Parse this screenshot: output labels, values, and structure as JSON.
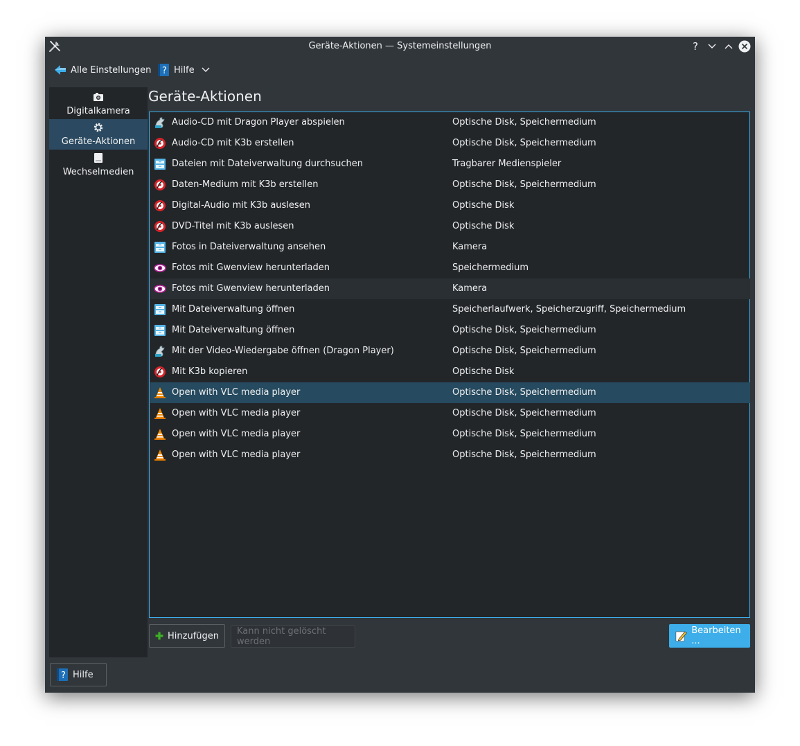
{
  "window": {
    "title": "Geräte-Aktionen — Systemeinstellungen",
    "help_glyph": "?"
  },
  "toolbar": {
    "back_label": "Alle Einstellungen",
    "help_label": "Hilfe"
  },
  "sidebar": {
    "items": [
      {
        "label": "Digitalkamera",
        "icon": "camera-icon"
      },
      {
        "label": "Geräte-Aktionen",
        "icon": "gear-icon",
        "active": true
      },
      {
        "label": "Wechselmedien",
        "icon": "drive-icon"
      }
    ]
  },
  "main": {
    "title": "Geräte-Aktionen",
    "rows": [
      {
        "action": "Audio-CD mit Dragon Player abspielen",
        "devices": "Optische Disk, Speichermedium",
        "icon": "dragon-player-icon"
      },
      {
        "action": "Audio-CD mit K3b erstellen",
        "devices": "Optische Disk, Speichermedium",
        "icon": "k3b-icon"
      },
      {
        "action": "Dateien mit Dateiverwaltung durchsuchen",
        "devices": "Tragbarer Medienspieler",
        "icon": "file-manager-icon"
      },
      {
        "action": "Daten-Medium mit K3b erstellen",
        "devices": "Optische Disk, Speichermedium",
        "icon": "k3b-icon"
      },
      {
        "action": "Digital-Audio mit K3b auslesen",
        "devices": "Optische Disk",
        "icon": "k3b-icon"
      },
      {
        "action": "DVD-Titel mit K3b auslesen",
        "devices": "Optische Disk",
        "icon": "k3b-icon"
      },
      {
        "action": "Fotos in Dateiverwaltung ansehen",
        "devices": "Kamera",
        "icon": "file-manager-icon"
      },
      {
        "action": "Fotos mit Gwenview herunterladen",
        "devices": "Speichermedium",
        "icon": "gwenview-icon"
      },
      {
        "action": "Fotos mit Gwenview herunterladen",
        "devices": "Kamera",
        "icon": "gwenview-icon",
        "hover": true
      },
      {
        "action": "Mit Dateiverwaltung öffnen",
        "devices": "Speicherlaufwerk, Speicherzugriff, Speichermedium",
        "icon": "file-manager-icon"
      },
      {
        "action": "Mit Dateiverwaltung öffnen",
        "devices": "Optische Disk, Speichermedium",
        "icon": "file-manager-icon"
      },
      {
        "action": "Mit der Video-Wiedergabe öffnen (Dragon Player)",
        "devices": "Optische Disk, Speichermedium",
        "icon": "dragon-player-icon"
      },
      {
        "action": "Mit K3b kopieren",
        "devices": "Optische Disk",
        "icon": "k3b-icon"
      },
      {
        "action": "Open with VLC media player",
        "devices": "Optische Disk, Speichermedium",
        "icon": "vlc-icon",
        "selected": true
      },
      {
        "action": "Open with VLC media player",
        "devices": "Optische Disk, Speichermedium",
        "icon": "vlc-icon"
      },
      {
        "action": "Open with VLC media player",
        "devices": "Optische Disk, Speichermedium",
        "icon": "vlc-icon"
      },
      {
        "action": "Open with VLC media player",
        "devices": "Optische Disk, Speichermedium",
        "icon": "vlc-icon"
      }
    ],
    "add_label": "Hinzufügen",
    "delete_label": "Kann nicht gelöscht werden",
    "edit_label": "Bearbeiten ..."
  },
  "footer": {
    "help_label": "Hilfe"
  },
  "colors": {
    "accent": "#3daee9",
    "window_bg": "#31363b",
    "view_bg": "#232629",
    "selection": "#264a5f"
  }
}
